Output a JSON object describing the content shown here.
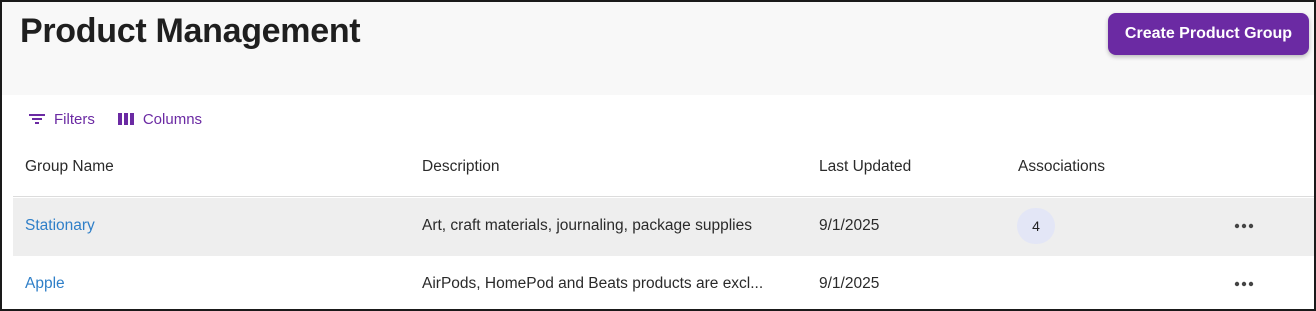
{
  "header": {
    "title": "Product Management",
    "create_button_label": "Create Product Group"
  },
  "toolbar": {
    "filters_label": "Filters",
    "columns_label": "Columns"
  },
  "table": {
    "columns": [
      "Group Name",
      "Description",
      "Last Updated",
      "Associations"
    ],
    "rows": [
      {
        "group_name": "Stationary",
        "description": "Art, craft materials, journaling, package supplies",
        "last_updated": "9/1/2025",
        "associations": "4"
      },
      {
        "group_name": "Apple",
        "description": "AirPods, HomePod and Beats products are excl...",
        "last_updated": "9/1/2025",
        "associations": ""
      }
    ]
  },
  "icons": {
    "filter": "filter-icon",
    "columns": "columns-icon",
    "more": "more-horizontal-icon"
  },
  "colors": {
    "accent": "#6b2aa3",
    "link": "#2f7fc8",
    "selected_row": "#eeeeee",
    "badge_bg": "#e3e6f6"
  }
}
